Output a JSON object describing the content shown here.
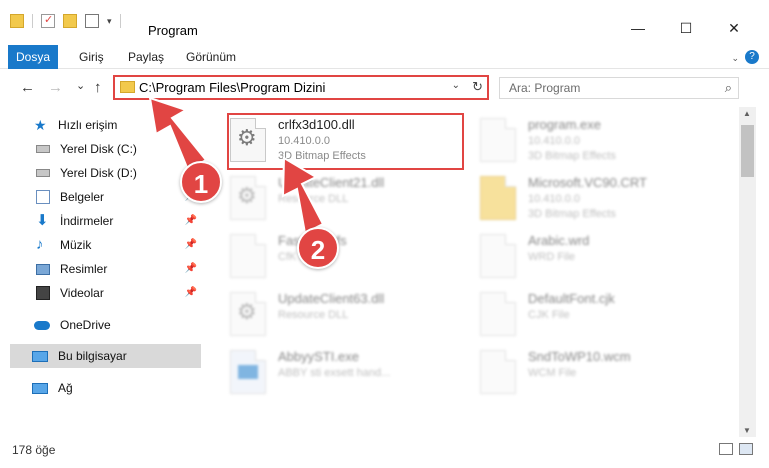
{
  "window": {
    "title": "Program",
    "minimize": "—",
    "maximize": "☐",
    "close": "✕"
  },
  "ribbon": {
    "tabs": [
      "Dosya",
      "Giriş",
      "Paylaş",
      "Görünüm"
    ],
    "help": "?"
  },
  "nav": {
    "back": "←",
    "forward": "→",
    "recent": "⌄",
    "up": "↑",
    "address": "C:\\Program Files\\Program Dizini",
    "search_placeholder": "Ara: Program"
  },
  "sidebar": {
    "items": [
      {
        "label": "Hızlı erişim",
        "icon": "star-icon"
      },
      {
        "label": "Yerel Disk (C:)",
        "icon": "drive-icon"
      },
      {
        "label": "Yerel Disk (D:)",
        "icon": "drive-icon"
      },
      {
        "label": "Belgeler",
        "icon": "documents-icon"
      },
      {
        "label": "İndirmeler",
        "icon": "download-icon"
      },
      {
        "label": "Müzik",
        "icon": "music-icon"
      },
      {
        "label": "Resimler",
        "icon": "pictures-icon"
      },
      {
        "label": "Videolar",
        "icon": "video-icon"
      },
      {
        "label": "OneDrive",
        "icon": "cloud-icon"
      },
      {
        "label": "Bu bilgisayar",
        "icon": "computer-icon"
      },
      {
        "label": "Ağ",
        "icon": "network-icon"
      }
    ]
  },
  "files": [
    {
      "name": "crlfx3d100.dll",
      "line1": "10.410.0.0",
      "line2": "3D Bitmap Effects"
    },
    {
      "name": "program.exe",
      "line1": "10.410.0.0",
      "line2": "3D Bitmap Effects"
    },
    {
      "name": "UpdateClient21.dll",
      "line1": "Resource DLL",
      "line2": ""
    },
    {
      "name": "Microsoft.VC90.CRT",
      "line1": "10.410.0.0",
      "line2": "3D Bitmap Effects"
    },
    {
      "name": "FastRes.cfs",
      "line1": "CfK File",
      "line2": ""
    },
    {
      "name": "Arabic.wrd",
      "line1": "WRD File",
      "line2": ""
    },
    {
      "name": "UpdateClient63.dll",
      "line1": "Resource DLL",
      "line2": ""
    },
    {
      "name": "DefaultFont.cjk",
      "line1": "CJK File",
      "line2": ""
    },
    {
      "name": "AbbyySTI.exe",
      "line1": "ABBY sti exsett hand...",
      "line2": ""
    },
    {
      "name": "SndToWP10.wcm",
      "line1": "WCM File",
      "line2": ""
    }
  ],
  "status": {
    "count": "178 öğe"
  },
  "annotations": {
    "badge1": "1",
    "badge2": "2",
    "color": "#e14543"
  }
}
